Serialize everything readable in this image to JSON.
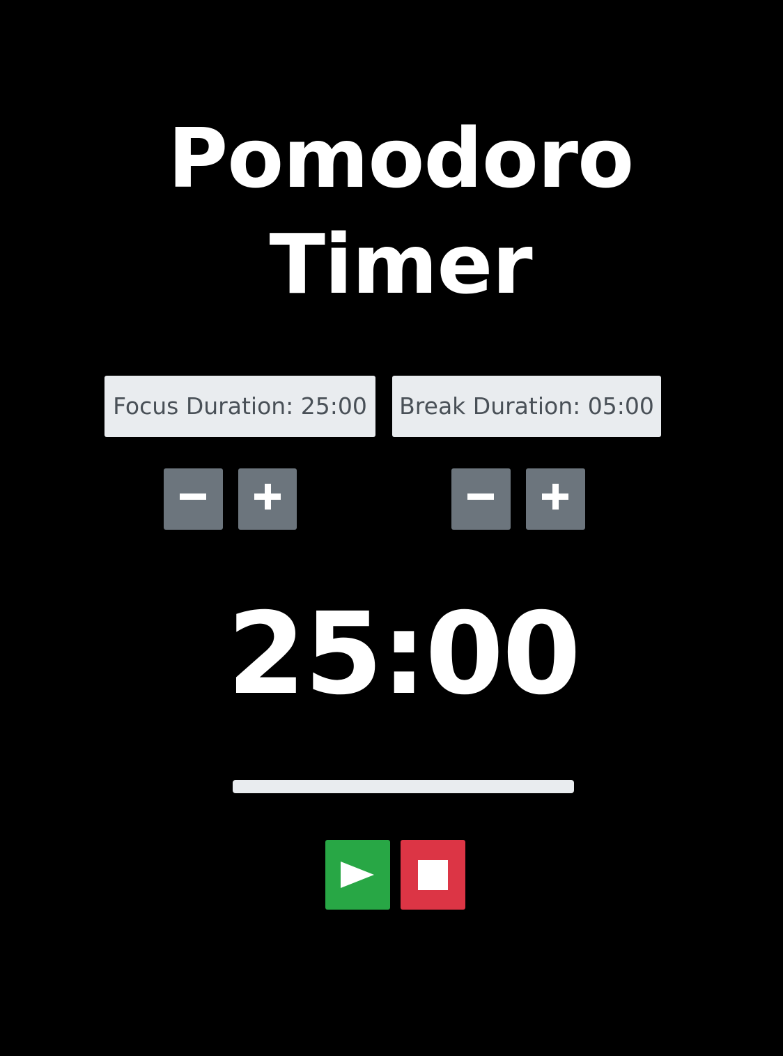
{
  "app": {
    "title_line1": "Pomodoro",
    "title_line2": "Timer"
  },
  "settings": {
    "focus_label": "Focus Duration: 25:00",
    "break_label": "Break Duration: 05:00",
    "decrement_icon": "minus-icon",
    "increment_icon": "plus-icon"
  },
  "timer": {
    "display": "25:00",
    "progress_percent": 0
  },
  "controls": {
    "play_icon": "play-icon",
    "stop_icon": "stop-icon"
  },
  "colors": {
    "background": "#000000",
    "secondary": "#6c757d",
    "light": "#e9ecef",
    "success": "#28a745",
    "danger": "#dc3545"
  }
}
